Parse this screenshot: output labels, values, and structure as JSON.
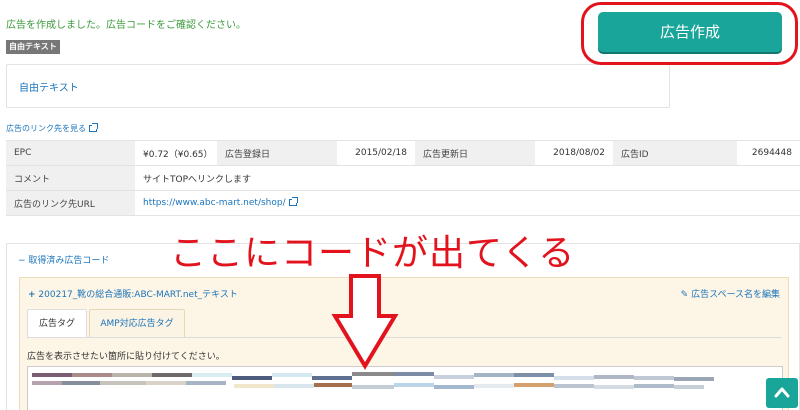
{
  "message": {
    "success": "広告を作成しました。広告コードをご確認ください。"
  },
  "free_text": {
    "badge": "自由テキスト",
    "link": "自由テキスト"
  },
  "create_button": {
    "label": "広告作成",
    "color": "#19a59a",
    "highlight_color": "#e3131e"
  },
  "link_preview": "広告のリンク先を見る",
  "info_table": {
    "epc_label": "EPC",
    "epc_value": "¥0.72（¥0.65）",
    "registered_label": "広告登録日",
    "registered_value": "2015/02/18",
    "updated_label": "広告更新日",
    "updated_value": "2018/08/02",
    "id_label": "広告ID",
    "id_value": "2694448",
    "comment_label": "コメント",
    "comment_value": "サイトTOPへリンクします",
    "url_label": "広告のリンク先URL",
    "url_value": "https://www.abc-mart.net/shop/"
  },
  "acquired": {
    "title": "取得済み広告コード",
    "ad_name": "200217_靴の総合通販:ABC-MART.net_テキスト",
    "edit_label": "広告スペース名を編集",
    "tabs": [
      "広告タグ",
      "AMP対応広告タグ"
    ],
    "instruction": "広告を表示させたい箇所に貼り付けてください。"
  },
  "annotation": "ここにコードが出てくる",
  "icons": [
    "external-link-icon",
    "minus-icon",
    "plus-icon",
    "pencil-icon",
    "down-arrow-icon",
    "chevron-up-icon"
  ]
}
